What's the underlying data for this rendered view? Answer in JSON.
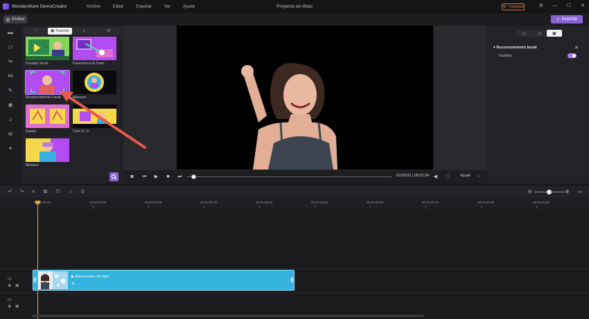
{
  "app": {
    "name": "Wondershare DemoCreator",
    "menu": [
      "Archivo",
      "Editar",
      "Exportar",
      "Ver",
      "Ayuda"
    ],
    "document_title": "Proyecto sin título",
    "buy_label": "Comprar"
  },
  "toolbar": {
    "record_label": "Grabar",
    "export_label": "Exportar"
  },
  "sidebar": {
    "icons": [
      "folder-icon",
      "caption-icon",
      "transition-icon",
      "marker-icon",
      "magic-effects-icon",
      "sticker-icon",
      "audio-icon",
      "cursor-icon",
      "pin-icon"
    ],
    "active": "magic-effects-icon"
  },
  "library": {
    "tabs": [
      {
        "label": "",
        "icon": "heart-icon"
      },
      {
        "label": "Función",
        "icon": "feature-icon"
      },
      {
        "label": "",
        "icon": "toggle-icon"
      },
      {
        "label": "",
        "icon": "list-icon"
      }
    ],
    "active_tab": 1,
    "items": [
      {
        "label": "Pantalla Verde"
      },
      {
        "label": "Panorámica & Zoom"
      },
      {
        "label": "Reconocimiento Facial"
      },
      {
        "label": "Máscara"
      },
      {
        "label": "Espejo"
      },
      {
        "label": "Cine 21: 9"
      },
      {
        "label": "Mosaico"
      }
    ],
    "selected_index": 2
  },
  "player": {
    "timecode": "00:00:02 | 00:01:34",
    "fit_label": "Ajuste",
    "progress": 0.03
  },
  "properties": {
    "section_title": "Reconocimiento facial",
    "enable_label": "Habilitar",
    "enabled": true,
    "accent_color": "#a07cff"
  },
  "timeline": {
    "ticks": [
      "00:00:00:00",
      "00:00:20:00",
      "00:00:40:00",
      "00:01:00:00",
      "00:01:20:00",
      "00:01:40:00",
      "00:02:00:00",
      "00:02:20:00",
      "00:02:40:00",
      "00:03:00:00"
    ],
    "tracks": [
      {
        "number": "02"
      },
      {
        "number": "01"
      }
    ],
    "clip": {
      "name": "democreator 04.mp4",
      "color": "#34b3de"
    },
    "playhead_color": "#e8a632"
  },
  "annotation": {
    "arrow_color": "#e8594b"
  }
}
